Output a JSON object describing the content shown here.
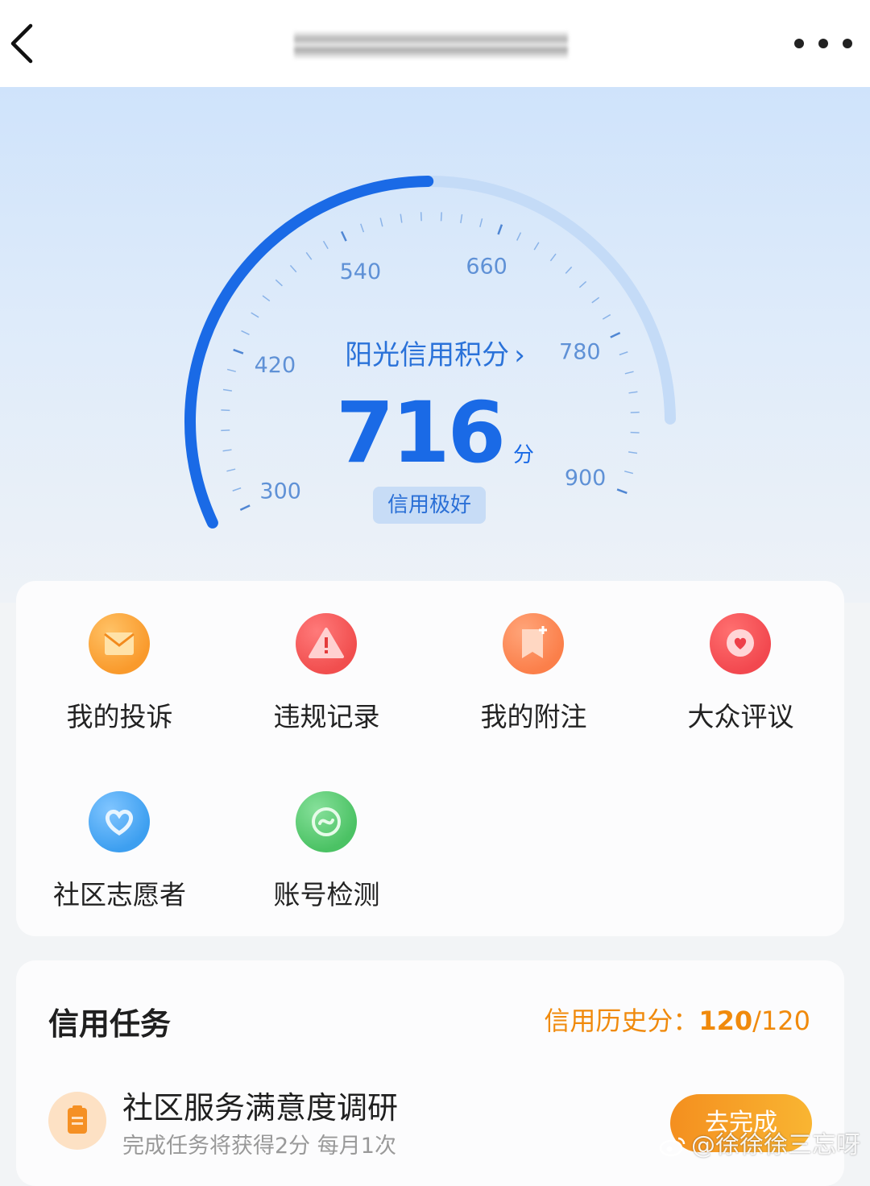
{
  "header": {
    "back_icon": "chevron-left-icon",
    "more_icon": "more-dots-icon"
  },
  "gauge": {
    "title": "阳光信用积分",
    "score": "716",
    "score_value": 716,
    "min": 300,
    "max": 900,
    "unit": "分",
    "level": "信用极好",
    "tick_labels": [
      "300",
      "420",
      "540",
      "660",
      "780",
      "900"
    ],
    "colors": {
      "progress": "#1a6ae6",
      "track": "#c4dbf7",
      "tick": "#8ab3e8"
    }
  },
  "services": [
    {
      "label": "我的投诉",
      "icon": "envelope-icon",
      "color": "#f99a2c"
    },
    {
      "label": "违规记录",
      "icon": "warning-icon",
      "color": "#f14e4e"
    },
    {
      "label": "我的附注",
      "icon": "bookmark-plus-icon",
      "color": "#fb7f4a"
    },
    {
      "label": "大众评议",
      "icon": "heart-chat-icon",
      "color": "#f2484f"
    },
    {
      "label": "社区志愿者",
      "icon": "heart-icon",
      "color": "#3d9ff0"
    },
    {
      "label": "账号检测",
      "icon": "scan-check-icon",
      "color": "#4bc264"
    }
  ],
  "tasks": {
    "title": "信用任务",
    "history_label": "信用历史分：",
    "history_current": "120",
    "history_total": "/120",
    "items": [
      {
        "title": "社区服务满意度调研",
        "desc": "完成任务将获得2分 每月1次",
        "action": "去完成",
        "icon": "clipboard-icon"
      }
    ]
  },
  "watermark": "@徐徐徐三忘呀"
}
